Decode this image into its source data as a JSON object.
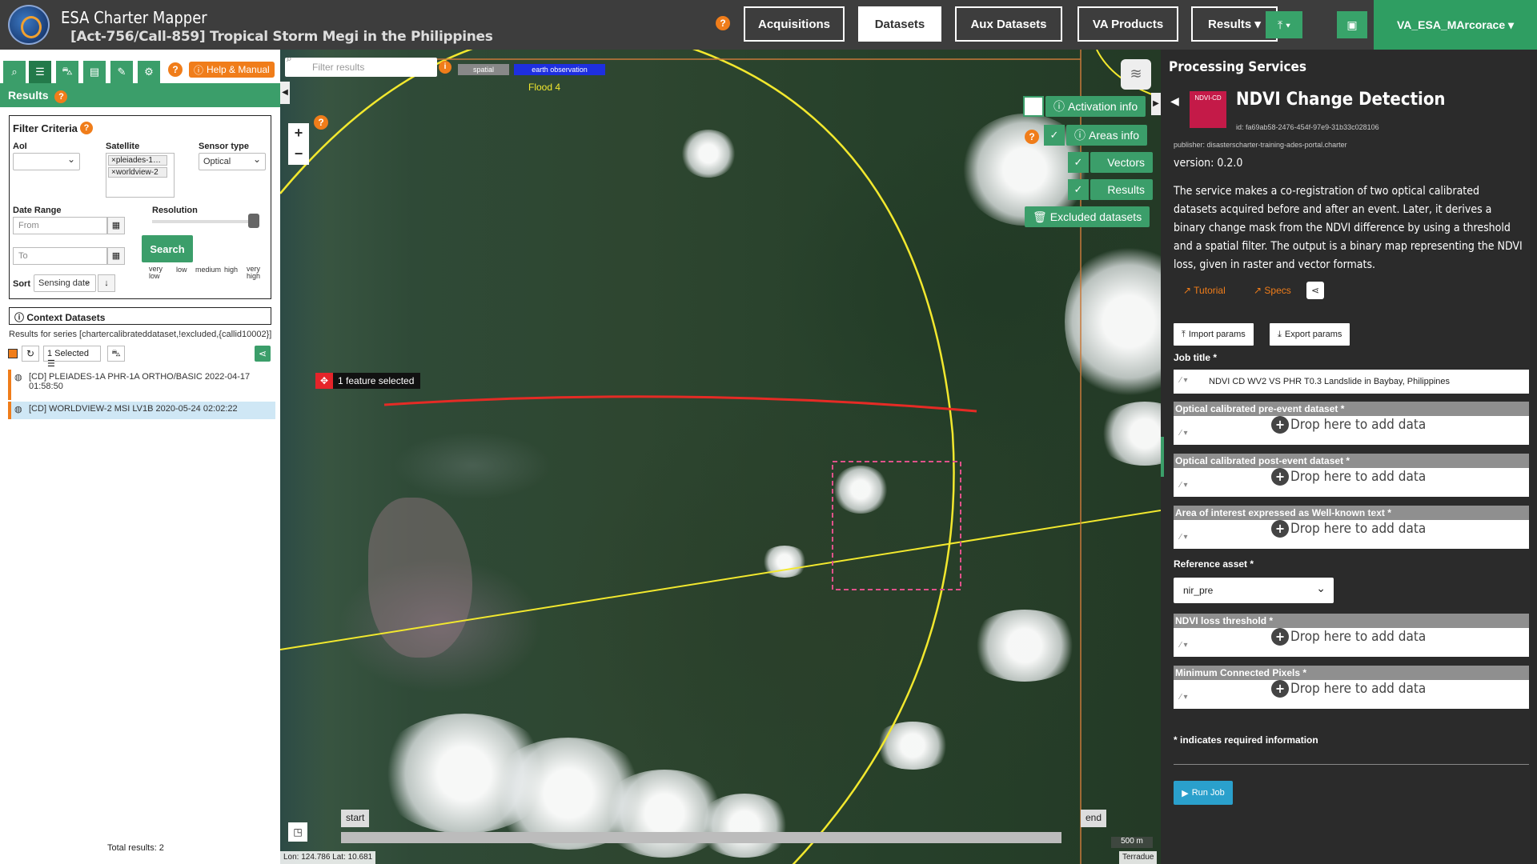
{
  "app": {
    "title": "ESA Charter Mapper",
    "subtitle": "[Act-756/Call-859] Tropical Storm Megi in the Philippines"
  },
  "nav": {
    "help": "?",
    "acquisitions": "Acquisitions",
    "datasets": "Datasets",
    "aux_datasets": "Aux Datasets",
    "va_products": "VA Products",
    "results": "Results ▾",
    "upload_icon": "upload-icon",
    "briefcase_icon": "briefcase-icon",
    "user": "VA_ESA_MArcorace ▾"
  },
  "left": {
    "help_manual": "Help & Manual",
    "results_label": "Results",
    "filter": {
      "title": "Filter Criteria",
      "aoi_label": "AoI",
      "aoi_value": "",
      "satellite_label": "Satellite",
      "satellite_values": [
        "×pleiades-1…",
        "×worldview-2"
      ],
      "sensor_label": "Sensor type",
      "sensor_value": "Optical",
      "date_label": "Date Range",
      "from_placeholder": "From",
      "to_placeholder": "To",
      "resolution_label": "Resolution",
      "resolution_ticks": [
        "very low",
        "low",
        "medium",
        "high",
        "very high"
      ],
      "search_label": "Search",
      "sort_label": "Sort",
      "sort_value": "Sensing date"
    },
    "context_title": "Context Datasets",
    "series_line": "Results for series [chartercalibrateddataset,!excluded,{callid10002}]",
    "selected_label": "1 Selected",
    "datasets": [
      "[CD] PLEIADES-1A PHR-1A ORTHO/BASIC 2022-04-17 01:58:50",
      "[CD] WORLDVIEW-2 MSI LV1B 2020-05-24 02:02:22"
    ],
    "total_results": "Total results: 2"
  },
  "map": {
    "filter_placeholder": "Filter results",
    "chip_spatial": "spatial",
    "chip_eo": "earth observation",
    "flood_label": "Flood 4",
    "zoom_in": "+",
    "zoom_out": "−",
    "activation_info": "Activation info",
    "areas_info": "Areas info",
    "vectors": "Vectors",
    "results": "Results",
    "excluded_datasets": "Excluded datasets",
    "feature_selected": "1 feature selected",
    "timeline_start": "start",
    "timeline_end": "end",
    "scale": "500 m",
    "coords": "Lon: 124.786 Lat: 10.681",
    "attribution": "Terradue"
  },
  "right": {
    "title": "Processing Services",
    "service_name": "NDVI Change Detection",
    "logo_text": "NDVI-CD",
    "service_id": "id: fa69ab58-2476-454f-97e9-31b33c028106",
    "publisher": "publisher: disasterscharter-training-ades-portal.charter",
    "version": "version: 0.2.0",
    "description": "The service makes a co-registration of two optical calibrated datasets acquired before and after an event. Later, it derives a binary change mask from the NDVI difference by using a threshold and a spatial filter. The output is a binary map representing the NDVI loss, given in raster and vector formats.",
    "tutorial": "Tutorial",
    "specs": "Specs",
    "import_params": "Import params",
    "export_params": "Export params",
    "job_title_label": "Job title *",
    "job_title_value": "NDVI CD WV2 VS PHR T0.3 Landslide in Baybay, Philippines",
    "drop_text": "Drop here to add data",
    "fields": [
      "Optical calibrated pre-event dataset *",
      "Optical calibrated post-event dataset *",
      "Area of interest expressed as Well-known text *"
    ],
    "reference_label": "Reference asset *",
    "reference_value": "nir_pre",
    "fields2": [
      "NDVI loss threshold *",
      "Minimum Connected Pixels *"
    ],
    "required_note": "* indicates required information",
    "run_job": "Run Job"
  }
}
